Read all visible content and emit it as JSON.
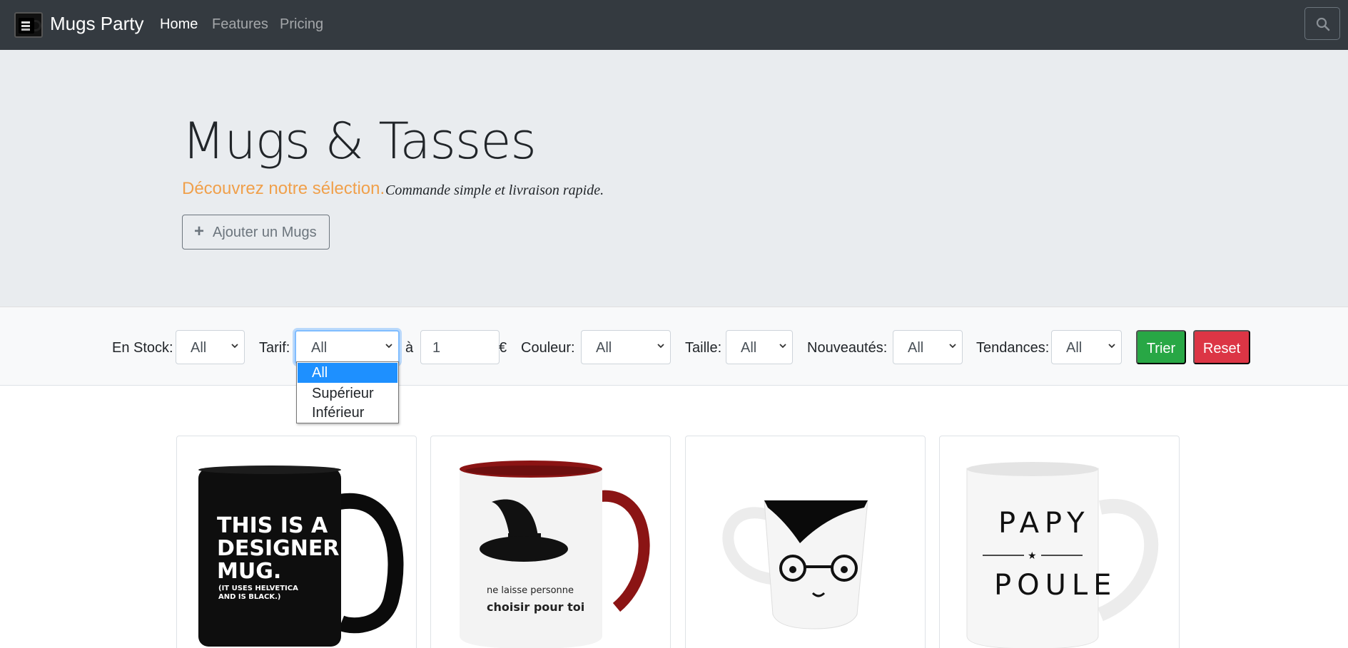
{
  "navbar": {
    "brand": "Mugs Party",
    "links": [
      {
        "label": "Home",
        "active": true
      },
      {
        "label": "Features",
        "active": false
      },
      {
        "label": "Pricing",
        "active": false
      }
    ],
    "search_icon": "search-icon"
  },
  "hero": {
    "title": "Mugs & Tasses",
    "lead_highlight": "Découvrez notre sélection.",
    "lead_text": "Commande simple et livraison rapide.",
    "add_button": "Ajouter un Mugs"
  },
  "filters": {
    "en_stock": {
      "label": "En Stock:",
      "value": "All"
    },
    "tarif": {
      "label": "Tarif:",
      "value": "All",
      "options": [
        "All",
        "Supérieur",
        "Inférieur"
      ],
      "open": true
    },
    "a_label": "à",
    "price": {
      "value": "1",
      "currency": "€"
    },
    "couleur": {
      "label": "Couleur:",
      "value": "All"
    },
    "taille": {
      "label": "Taille:",
      "value": "All"
    },
    "nouveautes": {
      "label": "Nouveautés:",
      "value": "All"
    },
    "tendances": {
      "label": "Tendances:",
      "value": "All"
    },
    "trier": "Trier",
    "reset": "Reset"
  },
  "products": [
    {
      "image": "black-designer-mug",
      "print_lines": [
        "THIS IS A",
        "DESIGNER",
        "MUG.",
        "(IT USES HELVETICA",
        "AND IS BLACK.)"
      ]
    },
    {
      "image": "witch-hat-mug",
      "print_lines": [
        "ne laisse personne",
        "choisir pour toi"
      ]
    },
    {
      "image": "glasses-face-mug",
      "print_lines": []
    },
    {
      "image": "papy-poule-mug",
      "print_lines": [
        "PAPY",
        "★",
        "POULE"
      ]
    }
  ],
  "colors": {
    "navbar": "#343a40",
    "hero_bg": "#e9ecef",
    "accent_orange": "#f0a04b",
    "success": "#28a745",
    "danger": "#dc3545",
    "selected_option": "#1e90ff"
  }
}
